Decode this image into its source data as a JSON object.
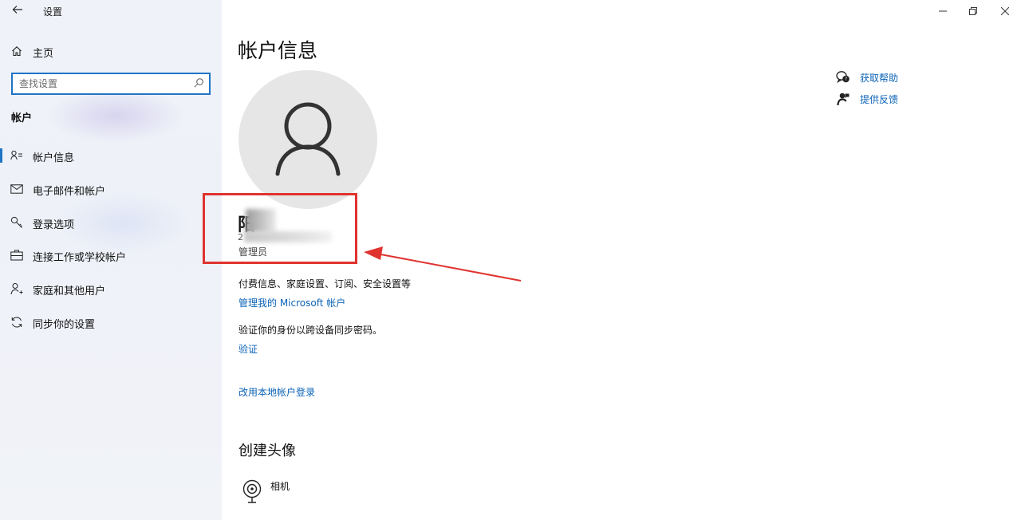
{
  "window": {
    "title": "设置",
    "back_icon": "arrow-left-icon",
    "controls": [
      "minimize-icon",
      "restore-icon",
      "close-icon"
    ]
  },
  "sidebar": {
    "home_label": "主页",
    "search": {
      "placeholder": "查找设置",
      "value": ""
    },
    "section_title": "帐户",
    "items": [
      {
        "label": "帐户信息",
        "icon": "account-info-icon",
        "active": true
      },
      {
        "label": "电子邮件和帐户",
        "icon": "mail-icon",
        "active": false
      },
      {
        "label": "登录选项",
        "icon": "key-icon",
        "active": false
      },
      {
        "label": "连接工作或学校帐户",
        "icon": "briefcase-icon",
        "active": false
      },
      {
        "label": "家庭和其他用户",
        "icon": "person-add-icon",
        "active": false
      },
      {
        "label": "同步你的设置",
        "icon": "sync-icon",
        "active": false
      }
    ]
  },
  "main": {
    "title": "帐户信息",
    "user": {
      "name": "阳",
      "email": "2",
      "role": "管理员"
    },
    "billing_desc": "付费信息、家庭设置、订阅、安全设置等",
    "manage_link": "管理我的 Microsoft 帐户",
    "verify_desc": "验证你的身份以跨设备同步密码。",
    "verify_link": "验证",
    "local_account_link": "改用本地帐户登录",
    "create_avatar_title": "创建头像",
    "camera_label": "相机"
  },
  "help": {
    "get_help": "获取帮助",
    "feedback": "提供反馈"
  },
  "colors": {
    "accent": "#1f74c6",
    "link": "#0b63b6",
    "annotation": "#e0332f"
  }
}
